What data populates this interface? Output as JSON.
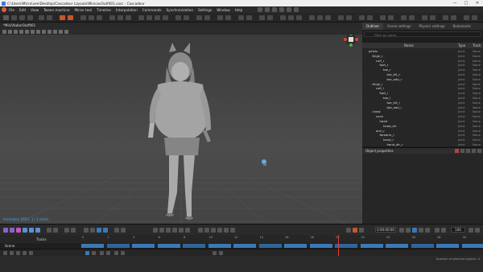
{
  "window": {
    "title": "C:\\Users\\Micro\\vee\\Desktop\\Cascadeur Layouts\\MinicavOutfit01.casc - Cascadeur",
    "controls": [
      "—",
      "□",
      "✕"
    ]
  },
  "menu": {
    "items": [
      "File",
      "Edit",
      "View",
      "Tween machine",
      "Mirror tool",
      "Timeline",
      "Interpolation",
      "Commands",
      "Synchronization",
      "Settings",
      "Window",
      "Help"
    ]
  },
  "viewport": {
    "tab_label": "*MiniVtuberOutfit01",
    "status_text": "Animation DOFs: 1 / 1 Items",
    "gizmo_colors": {
      "x": "#d9453a",
      "y": "#4caf50",
      "z": "#3a6fd9"
    }
  },
  "outliner": {
    "tabs": [
      "Outliner",
      "Scene settings",
      "Physics settings",
      "Bookmarks"
    ],
    "filter_placeholder": "Filter by name",
    "columns": {
      "name": "Name",
      "type": "Type",
      "track": "Track"
    },
    "rows": [
      {
        "name": "pelvis",
        "depth": 0,
        "type": "Joint",
        "track": "None"
      },
      {
        "name": "thigh_r",
        "depth": 1,
        "type": "Joint",
        "track": "None"
      },
      {
        "name": "calf_r",
        "depth": 2,
        "type": "Joint",
        "track": "None"
      },
      {
        "name": "foot_r",
        "depth": 3,
        "type": "Joint",
        "track": "None"
      },
      {
        "name": "toe_r",
        "depth": 4,
        "type": "Joint",
        "track": "None"
      },
      {
        "name": "toe_tilt_r",
        "depth": 5,
        "type": "Joint",
        "track": "None"
      },
      {
        "name": "toe_add_r",
        "depth": 5,
        "type": "Joint",
        "track": "None"
      },
      {
        "name": "thigh_l",
        "depth": 1,
        "type": "Joint",
        "track": "None"
      },
      {
        "name": "calf_l",
        "depth": 2,
        "type": "Joint",
        "track": "None"
      },
      {
        "name": "foot_l",
        "depth": 3,
        "type": "Joint",
        "track": "None"
      },
      {
        "name": "toe_l",
        "depth": 4,
        "type": "Joint",
        "track": "None"
      },
      {
        "name": "toe_tilt_l",
        "depth": 5,
        "type": "Joint",
        "track": "None"
      },
      {
        "name": "toe_add_l",
        "depth": 5,
        "type": "Joint",
        "track": "None"
      },
      {
        "name": "chest",
        "depth": 1,
        "type": "Joint",
        "track": "None"
      },
      {
        "name": "neck",
        "depth": 2,
        "type": "Joint",
        "track": "None"
      },
      {
        "name": "head",
        "depth": 3,
        "type": "Joint",
        "track": "None"
      },
      {
        "name": "head_dir",
        "depth": 4,
        "type": "Joint",
        "track": "None"
      },
      {
        "name": "arm_r",
        "depth": 2,
        "type": "Joint",
        "track": "None"
      },
      {
        "name": "forearm_r",
        "depth": 3,
        "type": "Joint",
        "track": "None"
      },
      {
        "name": "hand_r",
        "depth": 4,
        "type": "Joint",
        "track": "None"
      },
      {
        "name": "hand_dir_r",
        "depth": 5,
        "type": "Joint",
        "track": "None"
      }
    ]
  },
  "object_properties": {
    "label": "Object properties"
  },
  "playback": {
    "timecode": "0:00:00:00",
    "fps": "100"
  },
  "timeline": {
    "tracks_label": "Tracks",
    "scene_label": "Scene",
    "ruler_numbers": [
      "0",
      "2",
      "4",
      "6",
      "8",
      "10",
      "12",
      "14",
      "16",
      "18",
      "20",
      "22",
      "24",
      "26",
      "28",
      "30"
    ],
    "current_frame": "18",
    "status_right": "Number of selected objects: 0"
  }
}
